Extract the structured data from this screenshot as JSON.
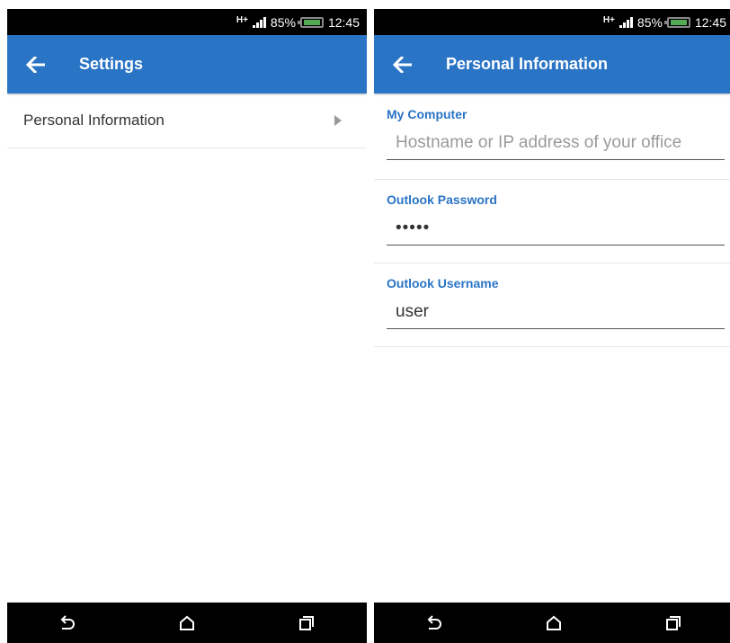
{
  "status": {
    "network": "H+",
    "battery": "85%",
    "time": "12:45"
  },
  "left_screen": {
    "title": "Settings",
    "item_label": "Personal Information"
  },
  "right_screen": {
    "title": "Personal Information",
    "fields": [
      {
        "label": "My Computer",
        "value": "",
        "placeholder": "Hostname or IP address of your office"
      },
      {
        "label": "Outlook Password",
        "value": "•••••",
        "placeholder": ""
      },
      {
        "label": "Outlook Username",
        "value": "user",
        "placeholder": ""
      }
    ]
  },
  "colors": {
    "app_bar": "#2a74c5",
    "status_bar": "#000000",
    "nav_bar": "#000000"
  },
  "icons": {
    "back": "arrow-left-icon",
    "chevron": "chevron-right-icon",
    "nav_back": "back-icon",
    "nav_home": "home-icon",
    "nav_recents": "recents-icon"
  }
}
